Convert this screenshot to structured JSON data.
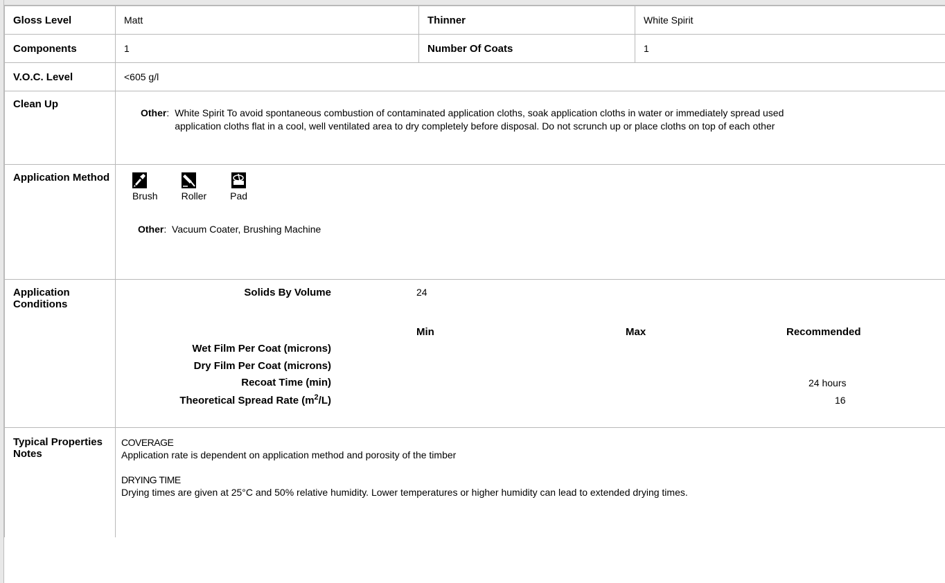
{
  "gloss": {
    "label": "Gloss Level",
    "value": "Matt"
  },
  "thinner": {
    "label": "Thinner",
    "value": "White Spirit"
  },
  "components": {
    "label": "Components",
    "value": "1"
  },
  "coats": {
    "label": "Number Of Coats",
    "value": "1"
  },
  "voc": {
    "label": "V.O.C. Level",
    "value": "<605 g/l"
  },
  "cleanup": {
    "label": "Clean Up",
    "other_label": "Other",
    "text_line1": "White Spirit To avoid spontaneous combustion of contaminated application cloths, soak application cloths in water or immediately spread used",
    "text_line2": "application cloths flat in a cool, well ventilated area to dry completely before disposal. Do not scrunch up or place cloths on top of each other"
  },
  "application_method": {
    "label": "Application Method",
    "methods": [
      {
        "name": "Brush",
        "icon": "brush-icon"
      },
      {
        "name": "Roller",
        "icon": "roller-icon"
      },
      {
        "name": "Pad",
        "icon": "pad-icon"
      }
    ],
    "other_label": "Other",
    "other_value": "Vacuum Coater, Brushing Machine"
  },
  "application_conditions": {
    "label": "Application Conditions",
    "solids_label": "Solids By Volume",
    "solids_value": "24",
    "col_min": "Min",
    "col_max": "Max",
    "col_rec": "Recommended",
    "rows": [
      {
        "label": "Wet Film Per Coat (microns)",
        "min": "",
        "max": "",
        "rec": ""
      },
      {
        "label": "Dry Film Per Coat (microns)",
        "min": "",
        "max": "",
        "rec": ""
      },
      {
        "label": "Recoat Time (min)",
        "min": "",
        "max": "",
        "rec": "24 hours"
      },
      {
        "label_pre": "Theoretical Spread Rate (m",
        "label_sup": "2",
        "label_post": "/L)",
        "min": "",
        "max": "",
        "rec": "16"
      }
    ]
  },
  "notes": {
    "label": "Typical Properties Notes",
    "coverage_title": "COVERAGE",
    "coverage_text": "Application rate is dependent on application method and porosity of the timber",
    "drying_title": "DRYING TIME",
    "drying_text": "Drying times are given at 25°C and 50% relative humidity. Lower temperatures or higher humidity can lead to extended drying times."
  }
}
